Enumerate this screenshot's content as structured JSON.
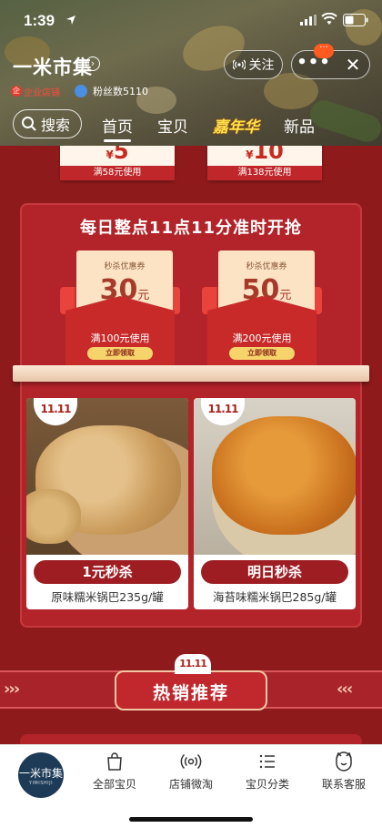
{
  "status_bar": {
    "time": "1:39"
  },
  "shop": {
    "name": "一米市集",
    "follow_label": "关注",
    "more_badge": "···",
    "corp_badge": "企业店铺",
    "fans": "粉丝数5110"
  },
  "nav": {
    "search_label": "搜索",
    "tabs": [
      "首页",
      "宝贝",
      "嘉年华",
      "新品"
    ],
    "active_tab": "首页"
  },
  "top_coupons": [
    {
      "amount": "5",
      "condition": "满58元使用"
    },
    {
      "amount": "10",
      "condition": "满138元使用"
    }
  ],
  "currency_symbol": "¥",
  "flash_sale": {
    "title": "每日整点11点11分准时开抢",
    "coupons": [
      {
        "card_title": "秒杀优惠券",
        "amount": "30",
        "unit": "元",
        "condition": "满100元使用",
        "claim_label": "立即领取"
      },
      {
        "card_title": "秒杀优惠券",
        "amount": "50",
        "unit": "元",
        "condition": "满200元使用",
        "claim_label": "立即领取"
      }
    ],
    "products": [
      {
        "tag": "11.11",
        "deal_label": "1元秒杀",
        "name": "原味糯米锅巴235g/罐"
      },
      {
        "tag": "11.11",
        "deal_label": "明日秒杀",
        "name": "海苔味糯米锅巴285g/罐"
      }
    ]
  },
  "hot_section": {
    "logo": "11.11",
    "title": "热销推荐"
  },
  "bottom_nav": {
    "logo_text": "一米市集",
    "logo_sub": "YIMISHIJI",
    "items": [
      {
        "label": "全部宝贝",
        "icon": "bag-icon"
      },
      {
        "label": "店铺微淘",
        "icon": "broadcast-icon"
      },
      {
        "label": "宝贝分类",
        "icon": "list-icon"
      },
      {
        "label": "联系客服",
        "icon": "service-icon"
      }
    ]
  },
  "colors": {
    "page_bg": "#8e1a1c",
    "panel_red": "#b3232a",
    "deal_pill": "#9e1d22",
    "coupon_cream": "#fbe3c4",
    "carnival_yellow": "#ffe24a"
  }
}
